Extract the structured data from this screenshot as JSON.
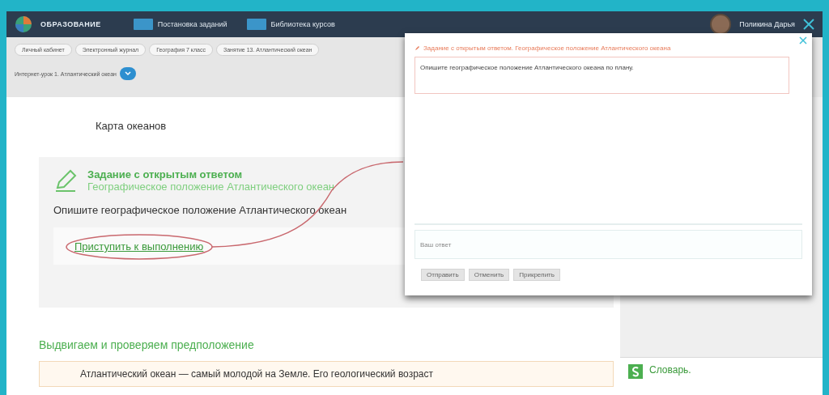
{
  "header": {
    "logo": "ОБРАЗОВАНИЕ",
    "nav": [
      {
        "label": "Постановка заданий"
      },
      {
        "label": "Библиотека курсов"
      }
    ],
    "user": "Поликина Дарья"
  },
  "breadcrumbs": [
    {
      "label": "Личный кабинет"
    },
    {
      "label": "Электронный журнал"
    },
    {
      "label": "География 7 класс"
    },
    {
      "label": "Занятие 13. Атлантический океан"
    }
  ],
  "lesson_select": {
    "value": "Интернет-урок 1. Атлантический океан"
  },
  "content": {
    "map_title": "Карта океанов",
    "task": {
      "type": "Задание с открытым ответом",
      "topic": "Географическое положение Атлантического океан",
      "question": "Опишите географическое положение Атлантического океан",
      "start_link": "Приступить к выполнению"
    },
    "section_title": "Выдвигаем и проверяем предположение",
    "paragraph": "Атлантический океан — самый молодой на Земле. Его геологический возраст"
  },
  "sidebar": {
    "glossary": "Словарь."
  },
  "modal": {
    "title": "Задание с открытым ответом. Географическое положение Атлантического океана",
    "question": "Опишите географическое положение Атлантического океана по плану.",
    "answer_placeholder": "Ваш ответ",
    "buttons": [
      {
        "label": "Отправить"
      },
      {
        "label": "Отменить"
      },
      {
        "label": "Прикрепить"
      }
    ]
  }
}
